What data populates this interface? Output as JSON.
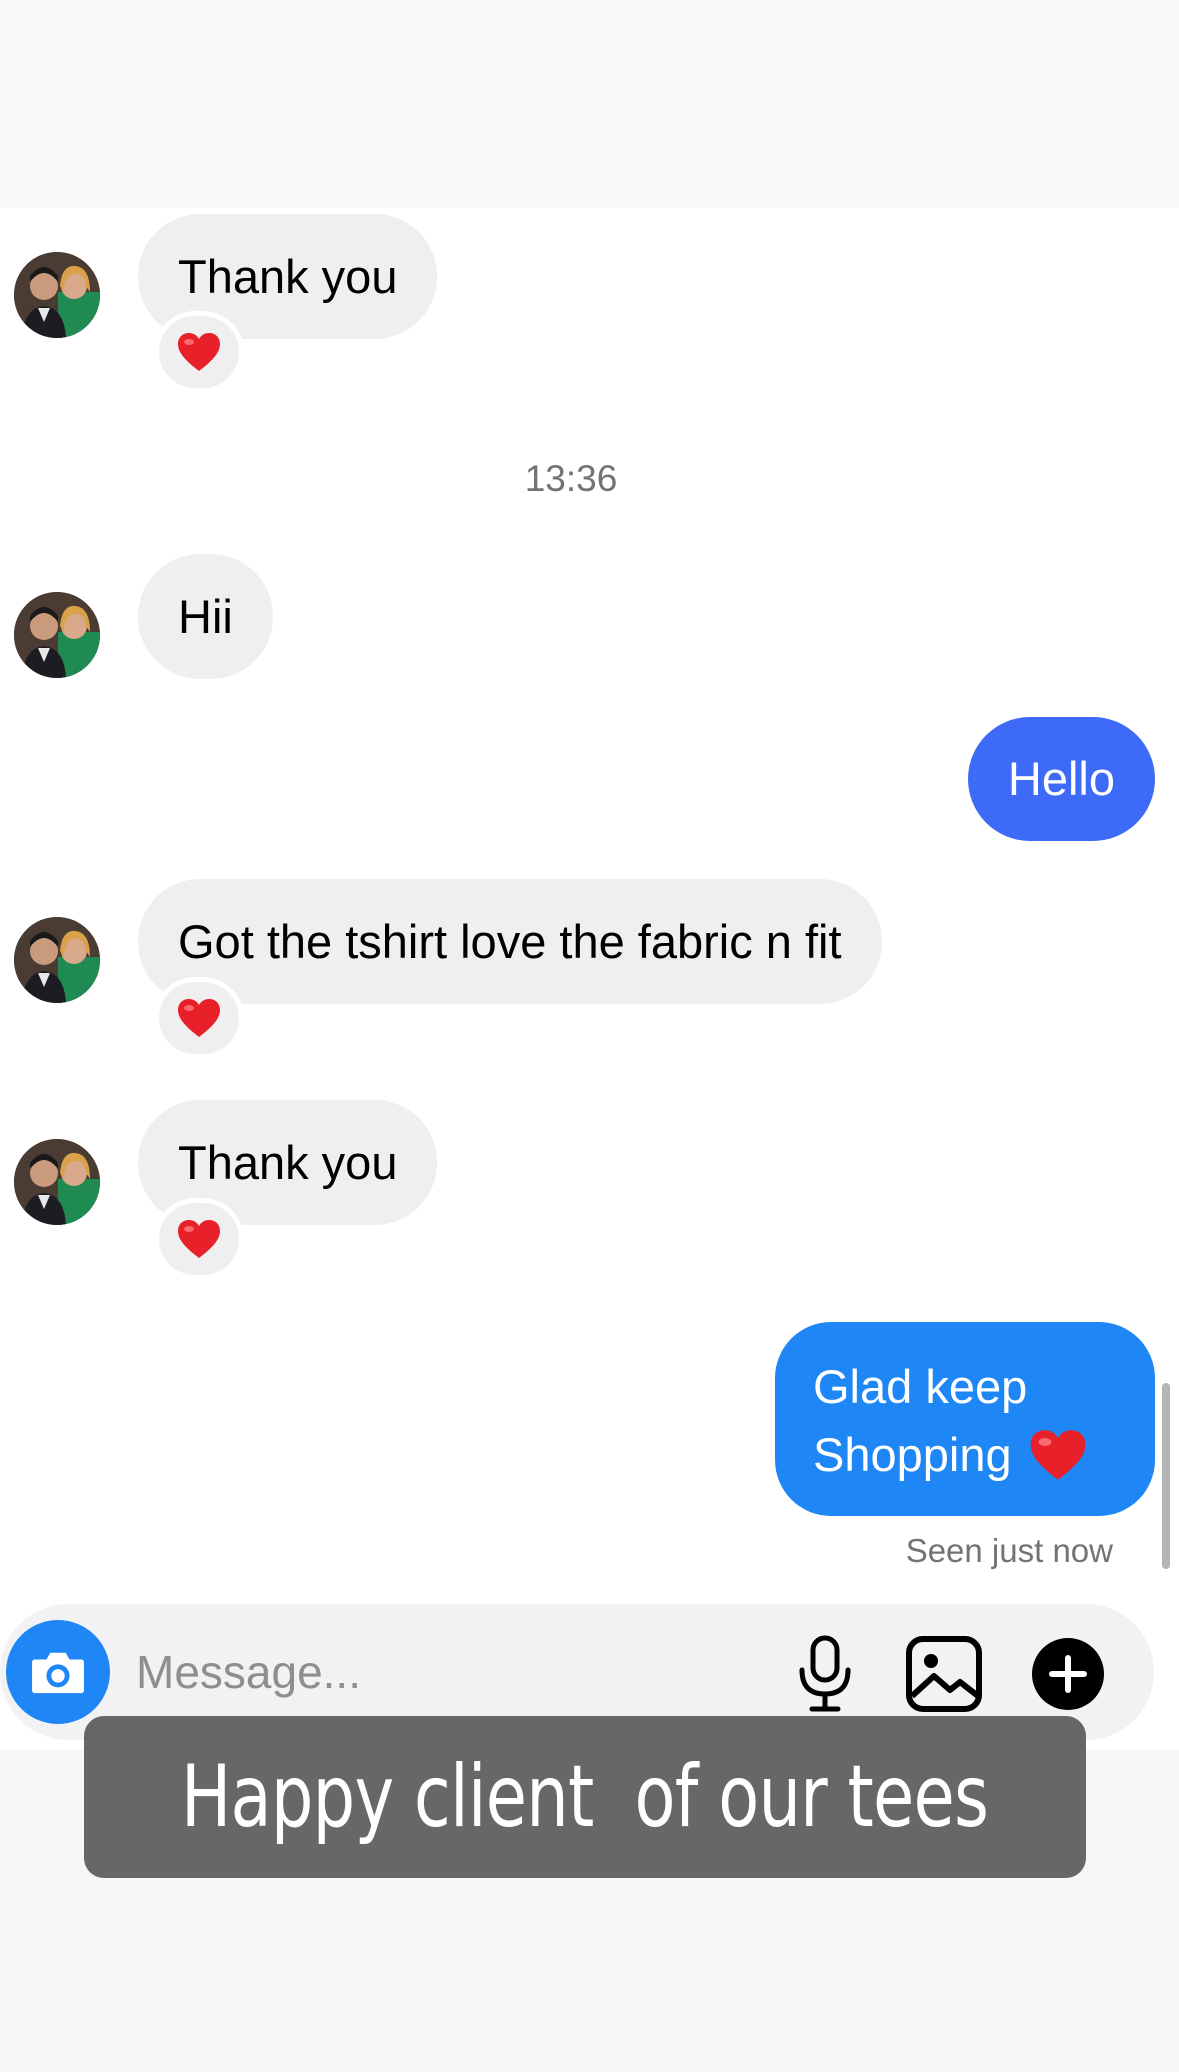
{
  "thread": {
    "messages": [
      {
        "direction": "incoming",
        "text": "Thank you",
        "reaction": "❤️"
      },
      {
        "type": "timestamp",
        "text": "13:36"
      },
      {
        "direction": "incoming",
        "text": "Hii"
      },
      {
        "direction": "outgoing",
        "text": "Hello"
      },
      {
        "direction": "incoming",
        "text": "Got the tshirt love the fabric n fit",
        "reaction": "❤️"
      },
      {
        "direction": "incoming",
        "text": "Thank you",
        "reaction": "❤️"
      },
      {
        "direction": "outgoing",
        "lines": [
          "Glad keep",
          "Shopping"
        ],
        "emoji": "❤️"
      }
    ],
    "seen_status": "Seen just now"
  },
  "composer": {
    "placeholder": "Message...",
    "icons": [
      "camera-icon",
      "microphone-icon",
      "image-icon",
      "plus-icon"
    ]
  },
  "overlay": {
    "caption": "Happy client  of our tees"
  },
  "colors": {
    "outgoing_bubble": "#3d6af7",
    "outgoing_bubble_last": "#1e87f5",
    "incoming_bubble": "#efefef",
    "heart": "#e8202a",
    "camera_button": "#1e87f5"
  }
}
